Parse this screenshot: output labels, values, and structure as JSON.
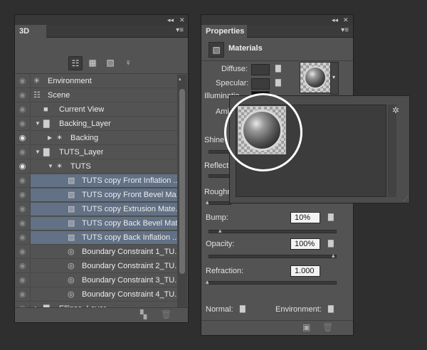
{
  "panel_3d": {
    "tab": "3D",
    "rows": [
      {
        "label": "Environment",
        "eye": "off",
        "selected": false
      },
      {
        "label": "Scene",
        "eye": "off",
        "selected": false
      },
      {
        "label": "Current View",
        "eye": "off",
        "selected": false
      },
      {
        "label": "Backing_Layer",
        "eye": "off",
        "selected": false
      },
      {
        "label": "Backing",
        "eye": "on",
        "selected": false
      },
      {
        "label": "TUTS_Layer",
        "eye": "off",
        "selected": false
      },
      {
        "label": "TUTS",
        "eye": "on",
        "selected": false
      },
      {
        "label": "TUTS copy Front Inflation ...",
        "eye": "off",
        "selected": true
      },
      {
        "label": "TUTS copy Front Bevel Ma...",
        "eye": "off",
        "selected": true
      },
      {
        "label": "TUTS copy Extrusion Mate...",
        "eye": "off",
        "selected": true
      },
      {
        "label": "TUTS copy Back Bevel Mat...",
        "eye": "off",
        "selected": true
      },
      {
        "label": "TUTS copy Back Inflation ...",
        "eye": "off",
        "selected": true
      },
      {
        "label": "Boundary Constraint 1_TU...",
        "eye": "off",
        "selected": false
      },
      {
        "label": "Boundary Constraint 2_TU...",
        "eye": "off",
        "selected": false
      },
      {
        "label": "Boundary Constraint 3_TU...",
        "eye": "off",
        "selected": false
      },
      {
        "label": "Boundary Constraint 4_TU...",
        "eye": "off",
        "selected": false
      },
      {
        "label": "Ellipse_Layer",
        "eye": "off",
        "selected": false
      }
    ]
  },
  "properties": {
    "tab": "Properties",
    "section_title": "Materials",
    "diffuse_label": "Diffuse:",
    "specular_label": "Specular:",
    "illumination_label": "Illuminatio",
    "ambient_label": "Ami",
    "shine_label": "Shine",
    "reflection_label": "Reflectio",
    "roughness_label": "Roughn",
    "bump_label": "Bump:",
    "bump_value": "10%",
    "opacity_label": "Opacity:",
    "opacity_value": "100%",
    "refraction_label": "Refraction:",
    "refraction_value": "1.000",
    "normal_label": "Normal:",
    "environment_label": "Environment:"
  },
  "glyphs": {
    "collapse": "◂◂",
    "close": "✕",
    "menu": "▾≡",
    "eye": "◉",
    "twist_open": "▼",
    "twist_closed": "▶",
    "folder": "▇",
    "gear": "✲",
    "arrow_down": "▾",
    "arrow_up": "▴"
  },
  "colors": {
    "selection": "#627185",
    "panel": "#535353",
    "background": "#2f2f2f"
  }
}
